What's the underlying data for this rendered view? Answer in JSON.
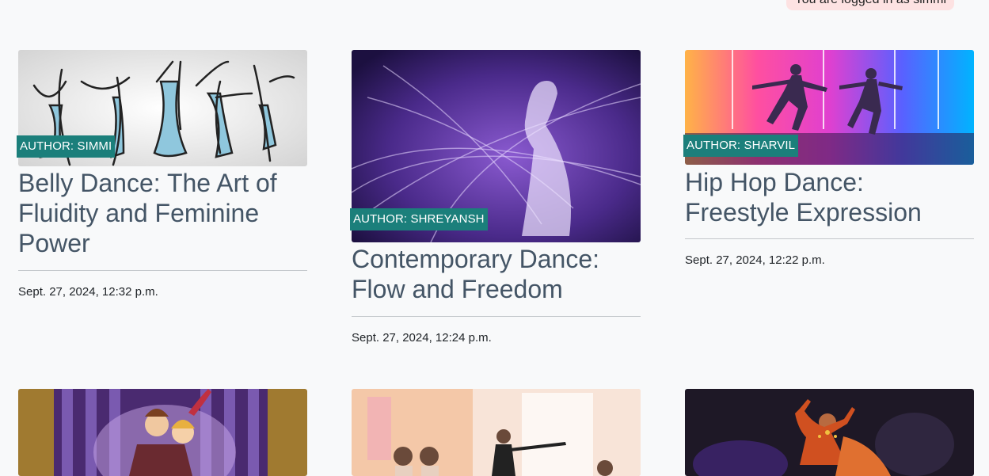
{
  "header": {
    "login_status": "You are logged in as simmi"
  },
  "posts": [
    {
      "author": "AUTHOR: SIMMI",
      "title": "Belly Dance: The Art of Fluidity and Feminine Power",
      "date": "Sept. 27, 2024, 12:32 p.m.",
      "image_icon": "belly-dance-silhouettes-image"
    },
    {
      "author": "AUTHOR: SHREYANSH",
      "title": "Contemporary Dance: Flow and Freedom",
      "date": "Sept. 27, 2024, 12:24 p.m.",
      "image_icon": "contemporary-dancer-image"
    },
    {
      "author": "AUTHOR: SHARVIL",
      "title": "Hip Hop Dance: Freestyle Expression",
      "date": "Sept. 27, 2024, 12:22 p.m.",
      "image_icon": "hip-hop-dancers-image"
    },
    {
      "image_icon": "ballroom-couple-image"
    },
    {
      "image_icon": "ballet-class-image"
    },
    {
      "image_icon": "classical-indian-dancer-image"
    }
  ],
  "colors": {
    "author_tag": "#1b7f7b",
    "title": "#445566",
    "background": "#f8f9fa",
    "login_badge": "#fde2e2"
  }
}
